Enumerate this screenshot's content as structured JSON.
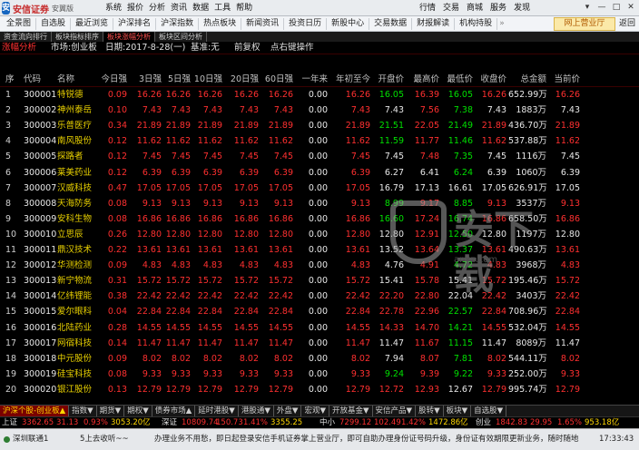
{
  "titlebar": {
    "logo_mark": "安",
    "brand": "安信证券",
    "edition": "安翼版",
    "menu": [
      "系统",
      "报价",
      "分析",
      "资讯",
      "数据",
      "工具",
      "帮助"
    ],
    "right_menu": [
      "行情",
      "交易",
      "商城",
      "服务",
      "发现"
    ],
    "window_controls": [
      "▾",
      "—",
      "□",
      "✕"
    ]
  },
  "toolbar": {
    "items": [
      "全景图",
      "自选股",
      "最近浏览",
      "沪深排名",
      "沪深指数",
      "热点板块",
      "新闻资讯",
      "投资日历",
      "新股中心",
      "交易数据",
      "财报解读",
      "机构持股"
    ],
    "more": "»",
    "wangshang": "网上营业厅",
    "back": "返回"
  },
  "tabs": {
    "items": [
      "资金流向排行",
      "板块指标排序",
      "板块涨幅分析",
      "板块区间分析"
    ],
    "active_index": 2
  },
  "subbar": {
    "analysis": "涨幅分析",
    "market": "市场:创业板",
    "date": "日期:2017-8-28(一)",
    "base": "基准:无",
    "adjust": "前复权",
    "hint": "点右键操作"
  },
  "table": {
    "headers": [
      "序",
      "代码",
      "名称",
      "今日强",
      "3日强",
      "5日强",
      "10日强",
      "20日强",
      "60日强",
      "一年来",
      "年初至今",
      "开盘价",
      "最高价",
      "最低价",
      "收盘价",
      "总金额",
      "当前价"
    ],
    "rows": [
      {
        "idx": "1",
        "code": "300001",
        "name": "特锐德",
        "today": "0.09",
        "d3": "16.26",
        "d5": "16.26",
        "d10": "16.26",
        "d20": "16.26",
        "d60": "16.26",
        "year": "0.00",
        "ytd": "16.26",
        "open": "16.05",
        "high": "16.39",
        "low": "16.05",
        "close": "16.26",
        "amount": "652.99万",
        "cur": "16.26",
        "colors": {
          "today": "r",
          "ytd": "r",
          "open": "g",
          "high": "r",
          "low": "g",
          "close": "r",
          "cur": "r"
        }
      },
      {
        "idx": "2",
        "code": "300002",
        "name": "神州泰岳",
        "today": "0.10",
        "d3": "7.43",
        "d5": "7.43",
        "d10": "7.43",
        "d20": "7.43",
        "d60": "7.43",
        "year": "0.00",
        "ytd": "7.43",
        "open": "7.43",
        "high": "7.56",
        "low": "7.38",
        "close": "7.43",
        "amount": "1883万",
        "cur": "7.43",
        "colors": {
          "today": "r",
          "ytd": "r",
          "open": "w",
          "high": "r",
          "low": "g",
          "close": "w",
          "cur": "w"
        }
      },
      {
        "idx": "3",
        "code": "300003",
        "name": "乐普医疗",
        "today": "0.34",
        "d3": "21.89",
        "d5": "21.89",
        "d10": "21.89",
        "d20": "21.89",
        "d60": "21.89",
        "year": "0.00",
        "ytd": "21.89",
        "open": "21.51",
        "high": "22.05",
        "low": "21.49",
        "close": "21.89",
        "amount": "436.70万",
        "cur": "21.89",
        "colors": {
          "today": "r",
          "ytd": "r",
          "open": "g",
          "high": "r",
          "low": "g",
          "close": "r",
          "cur": "r"
        }
      },
      {
        "idx": "4",
        "code": "300004",
        "name": "南风股份",
        "today": "0.12",
        "d3": "11.62",
        "d5": "11.62",
        "d10": "11.62",
        "d20": "11.62",
        "d60": "11.62",
        "year": "0.00",
        "ytd": "11.62",
        "open": "11.59",
        "high": "11.77",
        "low": "11.46",
        "close": "11.62",
        "amount": "537.88万",
        "cur": "11.62",
        "colors": {
          "today": "r",
          "ytd": "r",
          "open": "g",
          "high": "r",
          "low": "g",
          "close": "r",
          "cur": "r"
        }
      },
      {
        "idx": "5",
        "code": "300005",
        "name": "探路者",
        "today": "0.12",
        "d3": "7.45",
        "d5": "7.45",
        "d10": "7.45",
        "d20": "7.45",
        "d60": "7.45",
        "year": "0.00",
        "ytd": "7.45",
        "open": "7.45",
        "high": "7.48",
        "low": "7.35",
        "close": "7.45",
        "amount": "1116万",
        "cur": "7.45",
        "colors": {
          "today": "r",
          "ytd": "r",
          "open": "w",
          "high": "r",
          "low": "g",
          "close": "w",
          "cur": "w"
        }
      },
      {
        "idx": "6",
        "code": "300006",
        "name": "莱美药业",
        "today": "0.12",
        "d3": "6.39",
        "d5": "6.39",
        "d10": "6.39",
        "d20": "6.39",
        "d60": "6.39",
        "year": "0.00",
        "ytd": "6.39",
        "open": "6.27",
        "high": "6.41",
        "low": "6.24",
        "close": "6.39",
        "amount": "1060万",
        "cur": "6.39",
        "colors": {
          "today": "r",
          "ytd": "r",
          "open": "w",
          "high": "w",
          "low": "g",
          "close": "w",
          "cur": "w"
        }
      },
      {
        "idx": "7",
        "code": "300007",
        "name": "汉威科技",
        "today": "0.47",
        "d3": "17.05",
        "d5": "17.05",
        "d10": "17.05",
        "d20": "17.05",
        "d60": "17.05",
        "year": "0.00",
        "ytd": "17.05",
        "open": "16.79",
        "high": "17.13",
        "low": "16.61",
        "close": "17.05",
        "amount": "626.91万",
        "cur": "17.05",
        "colors": {
          "today": "r",
          "ytd": "r",
          "open": "w",
          "high": "w",
          "low": "w",
          "close": "w",
          "cur": "w"
        }
      },
      {
        "idx": "8",
        "code": "300008",
        "name": "天海防务",
        "today": "0.08",
        "d3": "9.13",
        "d5": "9.13",
        "d10": "9.13",
        "d20": "9.13",
        "d60": "9.13",
        "year": "0.00",
        "ytd": "9.13",
        "open": "8.99",
        "high": "9.17",
        "low": "8.85",
        "close": "9.13",
        "amount": "3537万",
        "cur": "9.13",
        "colors": {
          "today": "r",
          "ytd": "r",
          "open": "g",
          "high": "r",
          "low": "g",
          "close": "r",
          "cur": "r"
        }
      },
      {
        "idx": "9",
        "code": "300009",
        "name": "安科生物",
        "today": "0.08",
        "d3": "16.86",
        "d5": "16.86",
        "d10": "16.86",
        "d20": "16.86",
        "d60": "16.86",
        "year": "0.00",
        "ytd": "16.86",
        "open": "16.60",
        "high": "17.24",
        "low": "16.74",
        "close": "16.86",
        "amount": "658.50万",
        "cur": "16.86",
        "colors": {
          "today": "r",
          "ytd": "r",
          "open": "g",
          "high": "r",
          "low": "g",
          "close": "r",
          "cur": "r"
        }
      },
      {
        "idx": "10",
        "code": "300010",
        "name": "立思辰",
        "today": "0.26",
        "d3": "12.80",
        "d5": "12.80",
        "d10": "12.80",
        "d20": "12.80",
        "d60": "12.80",
        "year": "0.00",
        "ytd": "12.80",
        "open": "12.80",
        "high": "12.91",
        "low": "12.50",
        "close": "12.80",
        "amount": "1197万",
        "cur": "12.80",
        "colors": {
          "today": "r",
          "ytd": "r",
          "open": "w",
          "high": "r",
          "low": "g",
          "close": "w",
          "cur": "w"
        }
      },
      {
        "idx": "11",
        "code": "300011",
        "name": "鼎汉技术",
        "today": "0.22",
        "d3": "13.61",
        "d5": "13.61",
        "d10": "13.61",
        "d20": "13.61",
        "d60": "13.61",
        "year": "0.00",
        "ytd": "13.61",
        "open": "13.52",
        "high": "13.64",
        "low": "13.37",
        "close": "13.61",
        "amount": "490.63万",
        "cur": "13.61",
        "colors": {
          "today": "r",
          "ytd": "r",
          "open": "w",
          "high": "r",
          "low": "g",
          "close": "r",
          "cur": "r"
        }
      },
      {
        "idx": "12",
        "code": "300012",
        "name": "华测检测",
        "today": "0.09",
        "d3": "4.83",
        "d5": "4.83",
        "d10": "4.83",
        "d20": "4.83",
        "d60": "4.83",
        "year": "0.00",
        "ytd": "4.83",
        "open": "4.76",
        "high": "4.91",
        "low": "4.72",
        "close": "4.83",
        "amount": "3968万",
        "cur": "4.83",
        "colors": {
          "today": "r",
          "ytd": "r",
          "open": "w",
          "high": "r",
          "low": "g",
          "close": "r",
          "cur": "r"
        }
      },
      {
        "idx": "13",
        "code": "300013",
        "name": "新宁物流",
        "today": "0.31",
        "d3": "15.72",
        "d5": "15.72",
        "d10": "15.72",
        "d20": "15.72",
        "d60": "15.72",
        "year": "0.00",
        "ytd": "15.72",
        "open": "15.41",
        "high": "15.78",
        "low": "15.41",
        "close": "15.72",
        "amount": "195.46万",
        "cur": "15.72",
        "colors": {
          "today": "r",
          "ytd": "r",
          "open": "w",
          "high": "r",
          "low": "w",
          "close": "r",
          "cur": "r"
        }
      },
      {
        "idx": "14",
        "code": "300014",
        "name": "亿纬锂能",
        "today": "0.38",
        "d3": "22.42",
        "d5": "22.42",
        "d10": "22.42",
        "d20": "22.42",
        "d60": "22.42",
        "year": "0.00",
        "ytd": "22.42",
        "open": "22.20",
        "high": "22.80",
        "low": "22.04",
        "close": "22.42",
        "amount": "3403万",
        "cur": "22.42",
        "colors": {
          "today": "r",
          "ytd": "r",
          "open": "r",
          "high": "r",
          "low": "w",
          "close": "r",
          "cur": "r"
        }
      },
      {
        "idx": "15",
        "code": "300015",
        "name": "爱尔眼科",
        "today": "0.04",
        "d3": "22.84",
        "d5": "22.84",
        "d10": "22.84",
        "d20": "22.84",
        "d60": "22.84",
        "year": "0.00",
        "ytd": "22.84",
        "open": "22.78",
        "high": "22.96",
        "low": "22.57",
        "close": "22.84",
        "amount": "708.96万",
        "cur": "22.84",
        "colors": {
          "today": "r",
          "ytd": "r",
          "open": "r",
          "high": "r",
          "low": "g",
          "close": "r",
          "cur": "r"
        }
      },
      {
        "idx": "16",
        "code": "300016",
        "name": "北陆药业",
        "today": "0.28",
        "d3": "14.55",
        "d5": "14.55",
        "d10": "14.55",
        "d20": "14.55",
        "d60": "14.55",
        "year": "0.00",
        "ytd": "14.55",
        "open": "14.33",
        "high": "14.70",
        "low": "14.21",
        "close": "14.55",
        "amount": "532.04万",
        "cur": "14.55",
        "colors": {
          "today": "r",
          "ytd": "r",
          "open": "r",
          "high": "r",
          "low": "g",
          "close": "r",
          "cur": "r"
        }
      },
      {
        "idx": "17",
        "code": "300017",
        "name": "网宿科技",
        "today": "0.14",
        "d3": "11.47",
        "d5": "11.47",
        "d10": "11.47",
        "d20": "11.47",
        "d60": "11.47",
        "year": "0.00",
        "ytd": "11.47",
        "open": "11.47",
        "high": "11.67",
        "low": "11.15",
        "close": "11.47",
        "amount": "8089万",
        "cur": "11.47",
        "colors": {
          "today": "r",
          "ytd": "r",
          "open": "w",
          "high": "r",
          "low": "g",
          "close": "w",
          "cur": "w"
        }
      },
      {
        "idx": "18",
        "code": "300018",
        "name": "中元股份",
        "today": "0.09",
        "d3": "8.02",
        "d5": "8.02",
        "d10": "8.02",
        "d20": "8.02",
        "d60": "8.02",
        "year": "0.00",
        "ytd": "8.02",
        "open": "7.94",
        "high": "8.07",
        "low": "7.81",
        "close": "8.02",
        "amount": "544.11万",
        "cur": "8.02",
        "colors": {
          "today": "r",
          "ytd": "r",
          "open": "w",
          "high": "r",
          "low": "g",
          "close": "r",
          "cur": "r"
        }
      },
      {
        "idx": "19",
        "code": "300019",
        "name": "硅宝科技",
        "today": "0.08",
        "d3": "9.33",
        "d5": "9.33",
        "d10": "9.33",
        "d20": "9.33",
        "d60": "9.33",
        "year": "0.00",
        "ytd": "9.33",
        "open": "9.24",
        "high": "9.39",
        "low": "9.22",
        "close": "9.33",
        "amount": "252.00万",
        "cur": "9.33",
        "colors": {
          "today": "r",
          "ytd": "r",
          "open": "g",
          "high": "r",
          "low": "g",
          "close": "r",
          "cur": "r"
        }
      },
      {
        "idx": "20",
        "code": "300020",
        "name": "银江股份",
        "today": "0.13",
        "d3": "12.79",
        "d5": "12.79",
        "d10": "12.79",
        "d20": "12.79",
        "d60": "12.79",
        "year": "0.00",
        "ytd": "12.79",
        "open": "12.72",
        "high": "12.93",
        "low": "12.67",
        "close": "12.79",
        "amount": "995.74万",
        "cur": "12.79",
        "colors": {
          "today": "r",
          "ytd": "r",
          "open": "r",
          "high": "r",
          "low": "w",
          "close": "r",
          "cur": "r"
        }
      }
    ]
  },
  "watermark": {
    "text": "安下载",
    "sub": "anxz.com"
  },
  "bottom_tabs": {
    "items": [
      "沪深个股-创业板▲",
      "指数▼",
      "期货▼",
      "期权▼",
      "债券市场▲",
      "延时港股▼",
      "港股通▼",
      "外盘▼",
      "宏观▼",
      "开放基金▼",
      "安信产品▼",
      "股转▼",
      "板块▼",
      "自选股▼"
    ],
    "active_index": 0
  },
  "indexbar": {
    "items": [
      {
        "label": "上证",
        "value": "3362.65",
        "change": "31.13",
        "pct": "0.93%",
        "amount": "3053.20亿"
      },
      {
        "label": "深证",
        "value": "10809.74",
        "change": "150.73",
        "pct": "1.41%",
        "amount": "3355.25"
      },
      {
        "label": "中小",
        "value": "7299.12",
        "change": "102.49",
        "pct": "1.42%",
        "amount": "1472.86亿"
      },
      {
        "label": "创业",
        "value": "1842.83",
        "change": "29.95",
        "pct": "1.65%",
        "amount": "953.18亿"
      }
    ]
  },
  "statusbar": {
    "server": "深圳联通1",
    "conn": "5上去收听~~",
    "notice": "办理业务不用愁，即日起登录安信手机证券掌上营业厅，即可自助办理身份证号码升级，身份证有效期限更新业务，随时随地",
    "time": "17:33:43"
  },
  "colors": {
    "up": "#ff3030",
    "down": "#00e000",
    "flat": "#e8e8e8",
    "name": "#e8d000",
    "code": "#e8e8e8",
    "blue": "#3f7fff"
  }
}
